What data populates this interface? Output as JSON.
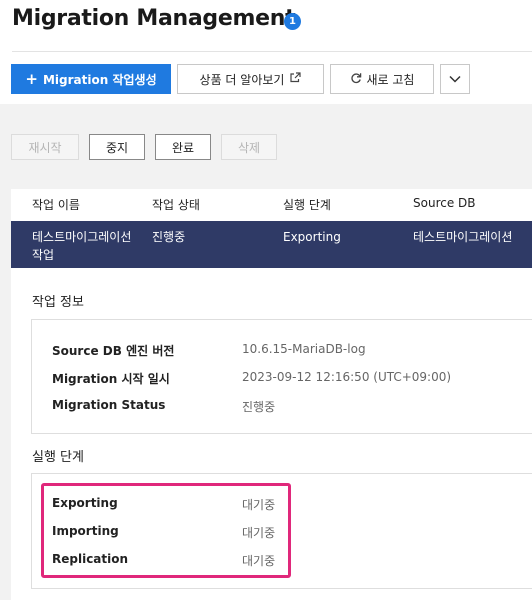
{
  "header": {
    "title": "Migration Management",
    "help_badge": "1",
    "create_button": "Migration 작업생성",
    "create_icon": "+",
    "learn_more_button": "상품 더 알아보기",
    "learn_more_icon": "external-link-icon",
    "refresh_button": "새로 고침",
    "refresh_icon": "refresh-icon",
    "dropdown_icon": "chevron-down-icon"
  },
  "actions": [
    {
      "label": "재시작",
      "enabled": false
    },
    {
      "label": "중지",
      "enabled": true
    },
    {
      "label": "완료",
      "enabled": true
    },
    {
      "label": "삭제",
      "enabled": false
    }
  ],
  "table": {
    "columns": [
      "작업 이름",
      "작업 상태",
      "실행 단계",
      "Source DB"
    ],
    "rows": [
      {
        "name": "테스트마이그레이선작업",
        "status": "진행중",
        "stage": "Exporting",
        "source_db": "테스트마이그레이션"
      }
    ]
  },
  "job_info": {
    "title": "작업 정보",
    "items": [
      {
        "label": "Source DB 엔진 버전",
        "value": "10.6.15-MariaDB-log"
      },
      {
        "label": "Migration 시작 일시",
        "value": "2023-09-12 12:16:50 (UTC+09:00)"
      },
      {
        "label": "Migration Status",
        "value": "진행중"
      }
    ]
  },
  "stages": {
    "title": "실행 단계",
    "items": [
      {
        "label": "Exporting",
        "value": "대기중"
      },
      {
        "label": "Importing",
        "value": "대기중"
      },
      {
        "label": "Replication",
        "value": "대기중"
      }
    ]
  },
  "colors": {
    "primary": "#1f7ae0",
    "selected_row": "#2f3a66",
    "highlight": "#e0287b"
  }
}
